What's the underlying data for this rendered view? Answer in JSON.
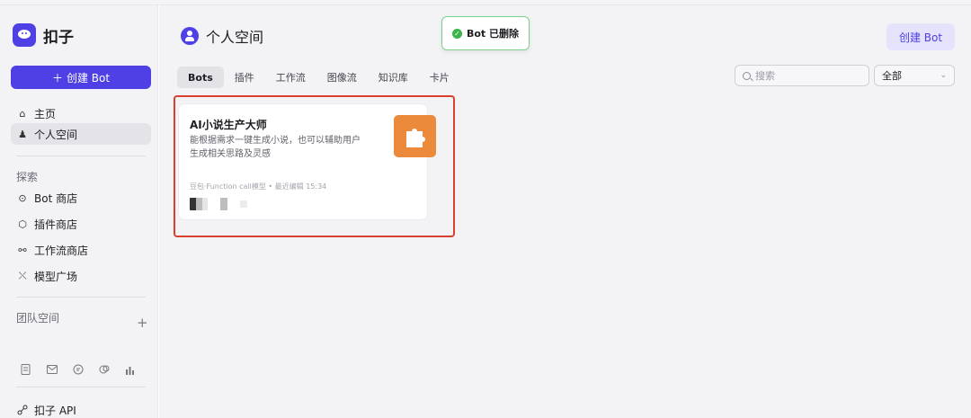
{
  "app": {
    "brand": "扣子"
  },
  "sidebar": {
    "create_label": "创建 Bot",
    "items_main": [
      {
        "label": "主页",
        "icon": "home-icon",
        "glyph": "⌂"
      },
      {
        "label": "个人空间",
        "icon": "person-icon",
        "glyph": "♟"
      }
    ],
    "explore_label": "探索",
    "items_explore": [
      {
        "label": "Bot 商店",
        "icon": "bot-store-icon",
        "glyph": "⊙"
      },
      {
        "label": "插件商店",
        "icon": "plugin-store-icon",
        "glyph": "⬡"
      },
      {
        "label": "工作流商店",
        "icon": "workflow-store-icon",
        "glyph": "⚯"
      },
      {
        "label": "模型广场",
        "icon": "model-plaza-icon",
        "glyph": "⤬"
      }
    ],
    "team_label": "团队空间",
    "api_label": "扣子 API"
  },
  "header": {
    "title": "个人空间",
    "create_button": "创建 Bot"
  },
  "toast": {
    "text": "Bot 已删除",
    "status": "success"
  },
  "tabs": [
    {
      "label": "Bots",
      "active": true
    },
    {
      "label": "插件",
      "active": false
    },
    {
      "label": "工作流",
      "active": false
    },
    {
      "label": "图像流",
      "active": false
    },
    {
      "label": "知识库",
      "active": false
    },
    {
      "label": "卡片",
      "active": false
    }
  ],
  "search": {
    "placeholder": "搜索"
  },
  "filter": {
    "value": "全部"
  },
  "card": {
    "title": "AI小说生产大师",
    "description": "能根据需求一键生成小说，也可以辅助用户生成相关思路及灵感",
    "meta": "豆包·Function call模型 • 最近编辑 15:34",
    "icon": "puzzle-icon"
  },
  "colors": {
    "accent": "#4e40e5",
    "highlight": "#d9402f",
    "success": "#3bb54a",
    "card_icon_bg": "#eb8a3a"
  }
}
